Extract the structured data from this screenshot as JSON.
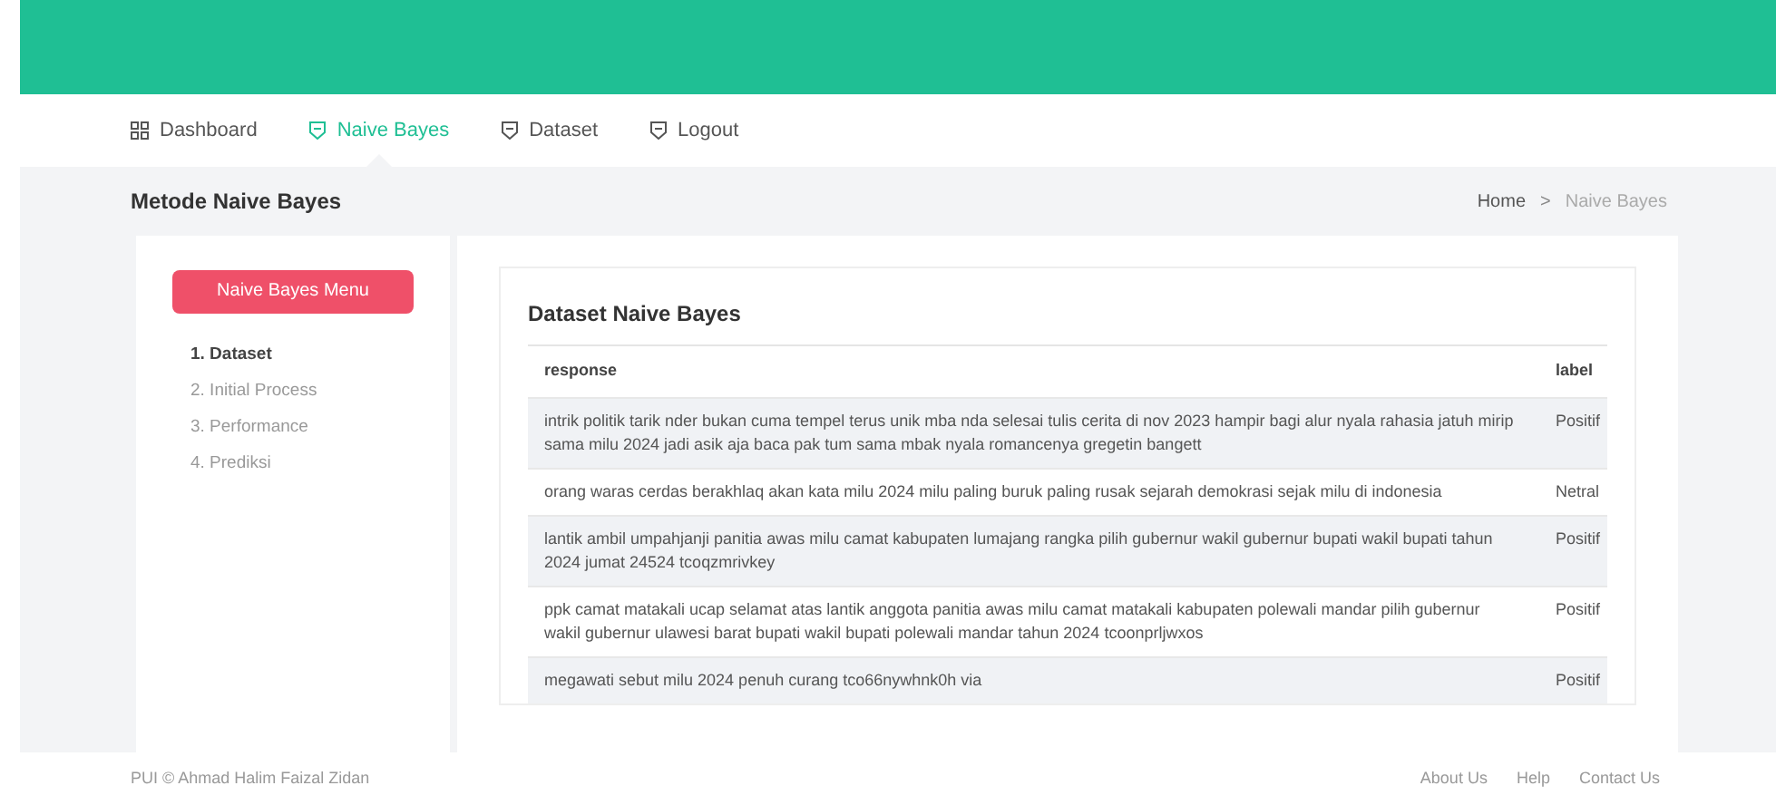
{
  "nav": [
    {
      "label": "Dashboard",
      "selected": false
    },
    {
      "label": "Naive Bayes",
      "selected": true
    },
    {
      "label": "Dataset",
      "selected": false
    },
    {
      "label": "Logout",
      "selected": false
    }
  ],
  "page_title": "Metode Naive Bayes",
  "breadcrumb_separator": ">",
  "breadcrumb": [
    {
      "label": "Home",
      "selected": false
    },
    {
      "label": "Naive Bayes",
      "selected": true
    }
  ],
  "sidebar": {
    "button": "Naive Bayes Menu",
    "items": [
      {
        "label": "1. Dataset",
        "selected": true
      },
      {
        "label": "2. Initial Process",
        "selected": false
      },
      {
        "label": "3. Performance",
        "selected": false
      },
      {
        "label": "4. Prediksi",
        "selected": false
      }
    ]
  },
  "card_title": "Dataset Naive Bayes",
  "table": {
    "columns": [
      "response",
      "label"
    ],
    "rows": [
      [
        "intrik politik tarik nder bukan cuma tempel terus unik mba nda selesai tulis cerita di nov 2023 hampir bagi alur nyala rahasia jatuh mirip sama milu 2024 jadi asik aja baca pak tum sama mbak nyala romancenya gregetin bangett",
        "Positif"
      ],
      [
        "orang waras cerdas berakhlaq akan kata milu 2024 milu paling buruk paling rusak sejarah demokrasi sejak milu di indonesia",
        "Netral"
      ],
      [
        "lantik ambil umpahjanji panitia awas milu camat kabupaten lumajang rangka pilih gubernur wakil gubernur bupati wakil bupati tahun 2024 jumat 24524 tcoqzmrivkey",
        "Positif"
      ],
      [
        "ppk camat matakali ucap selamat atas lantik anggota panitia awas milu camat matakali kabupaten polewali mandar pilih gubernur wakil gubernur ulawesi barat bupati wakil bupati polewali mandar tahun 2024 tcoonprljwxos",
        "Positif"
      ],
      [
        "megawati sebut milu 2024 penuh curang tco66nywhnk0h via",
        "Positif"
      ]
    ]
  },
  "footer": {
    "copyright": "PUI © Ahmad Halim Faizal Zidan",
    "links": [
      "About Us",
      "Help",
      "Contact Us"
    ]
  }
}
